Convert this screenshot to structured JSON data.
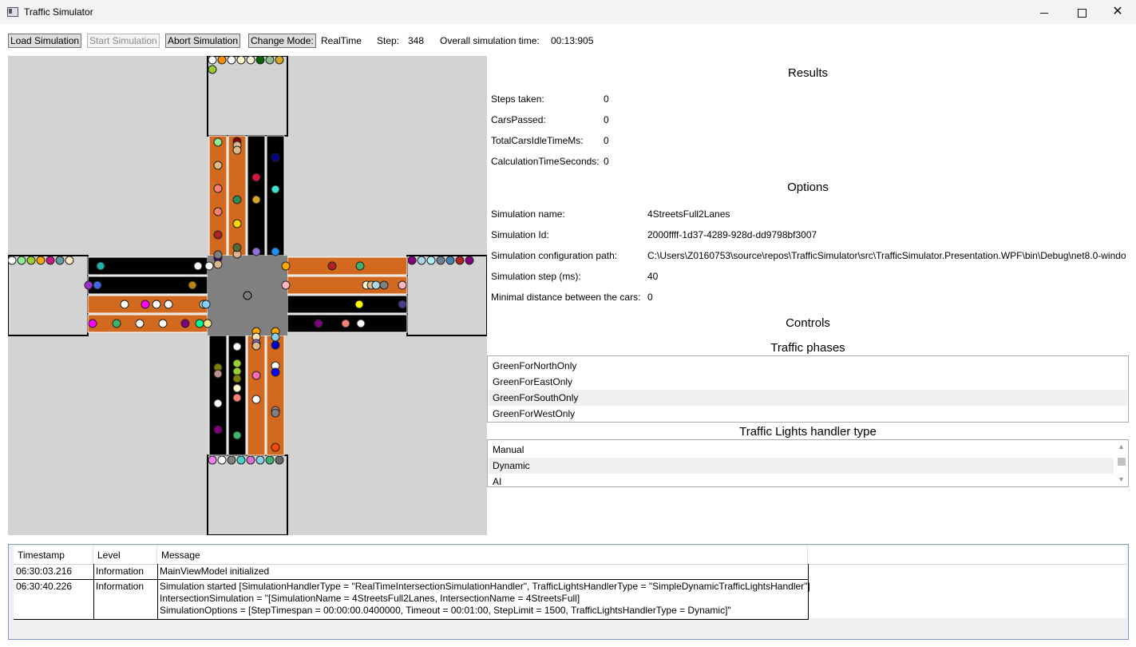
{
  "window": {
    "title": "Traffic Simulator",
    "app_icon": "app-window-icon",
    "controls": [
      "minimize-icon",
      "maximize-icon",
      "close-icon"
    ]
  },
  "toolbar": {
    "load": "Load Simulation",
    "start": "Start Simulation",
    "abort": "Abort Simulation",
    "change_mode": "Change Mode:",
    "mode_value": "RealTime",
    "step_label": "Step:",
    "step_value": "348",
    "overall_label": "Overall simulation time:",
    "overall_value": "00:13:905"
  },
  "results": {
    "title": "Results",
    "rows": [
      {
        "label": "Steps taken:",
        "value": "0"
      },
      {
        "label": "CarsPassed:",
        "value": "0"
      },
      {
        "label": "TotalCarsIdleTimeMs:",
        "value": "0"
      },
      {
        "label": "CalculationTimeSeconds:",
        "value": "0"
      }
    ]
  },
  "options": {
    "title": "Options",
    "rows": [
      {
        "label": "Simulation name:",
        "value": "4StreetsFull2Lanes"
      },
      {
        "label": "Simulation Id:",
        "value": "2000ffff-1d37-4289-928d-dd9798bf3007"
      },
      {
        "label": "Simulation configuration path:",
        "value": "C:\\Users\\Z0160753\\source\\repos\\TrafficSimulator\\src\\TrafficSimulator.Presentation.WPF\\bin\\Debug\\net8.0-windo"
      },
      {
        "label": "Simulation step (ms):",
        "value": "40"
      },
      {
        "label": "Minimal distance between the cars:",
        "value": "0"
      }
    ]
  },
  "controls": {
    "title": "Controls",
    "phases_title": "Traffic phases",
    "phases": [
      "GreenForNorthOnly",
      "GreenForEastOnly",
      "GreenForSouthOnly",
      "GreenForWestOnly"
    ],
    "phases_selected": "GreenForSouthOnly",
    "handler_title": "Traffic Lights handler type",
    "handlers": [
      "Manual",
      "Dynamic",
      "AI"
    ],
    "handler_selected": "Dynamic"
  },
  "log": {
    "columns": [
      "Timestamp",
      "Level",
      "Message"
    ],
    "rows": [
      {
        "timestamp": "06:30:03.216",
        "level": "Information",
        "message": [
          "MainViewModel initialized"
        ]
      },
      {
        "timestamp": "06:30:40.226",
        "level": "Information",
        "message": [
          "Simulation started [SimulationHandlerType = \"RealTimeIntersectionSimulationHandler\", TrafficLightsHandlerType = \"SimpleDynamicTrafficLightsHandler\"]",
          "IntersectionSimulation = \"[SimulationName = 4StreetsFull2Lanes, IntersectionName = 4StreetsFull]",
          "SimulationOptions = [StepTimespan = 00:00:00.0400000, Timeout = 00:01:00, StepLimit = 1500, TrafficLightsHandlerType = Dynamic]\""
        ]
      }
    ]
  },
  "colors": {
    "lane_green": "#d2691e",
    "lane_red": "#000000",
    "road_bg": "#d3d3d3",
    "intersection": "#808080"
  },
  "simulation_view": {
    "lanes": [
      {
        "id": "north-0",
        "state": "green",
        "cars": [
          "#90ee90",
          "#deb887",
          "#fa8072",
          "#fa8072",
          "#b22222",
          "#4b0082",
          "#deb887",
          "#808080"
        ]
      },
      {
        "id": "north-1",
        "state": "green",
        "cars": [
          "#8b0000",
          "#deb887",
          "#deb887",
          "#2e8b57",
          "#ffd700",
          "#deb887",
          "#556b2f"
        ]
      },
      {
        "id": "north-2",
        "state": "red",
        "cars": [
          "#dc143c",
          "#daa520",
          "#9370db"
        ]
      },
      {
        "id": "north-3",
        "state": "red",
        "cars": [
          "#00008b",
          "#40e0d0",
          "#1e90ff"
        ]
      },
      {
        "id": "east-0",
        "state": "green",
        "cars": [
          "#ffa500",
          "#b22222",
          "#3cb371"
        ]
      },
      {
        "id": "east-1",
        "state": "green",
        "cars": [
          "#ffb6c1",
          "#fffacd",
          "#deb887",
          "#add8e6",
          "#808080"
        ]
      },
      {
        "id": "east-2",
        "state": "red",
        "cars": [
          "#ffff00",
          "#483d8b"
        ]
      },
      {
        "id": "east-3",
        "state": "red",
        "cars": [
          "#800080",
          "#fa8072",
          "#ffffff"
        ]
      },
      {
        "id": "south-0",
        "state": "red",
        "cars": [
          "#808000",
          "#bc8f8f",
          "#ffffff",
          "#800080"
        ]
      },
      {
        "id": "south-1",
        "state": "red",
        "cars": [
          "#ffffff",
          "#9acd32",
          "#9acd32",
          "#808000",
          "#fffacd",
          "#fa8072",
          "#3cb371"
        ]
      },
      {
        "id": "south-2",
        "state": "green",
        "cars": [
          "#ffa500",
          "#f5deb3",
          "#9370db",
          "#ff69b4",
          "#ffffff",
          "#deb887"
        ]
      },
      {
        "id": "south-3",
        "state": "green",
        "cars": [
          "#ffa500",
          "#87ceeb",
          "#0000cd",
          "#ffffff",
          "#0000ff",
          "#bc8f8f",
          "#808080",
          "#ff4500"
        ]
      },
      {
        "id": "west-0",
        "state": "red",
        "cars": [
          "#20b2aa",
          "#ffffff",
          "#ffffff"
        ]
      },
      {
        "id": "west-1",
        "state": "red",
        "cars": [
          "#9932cc",
          "#4169e1",
          "#b8860b"
        ]
      },
      {
        "id": "west-2",
        "state": "green",
        "cars": [
          "#ffffff",
          "#ff00ff",
          "#ffffff",
          "#ffffff",
          "#afeeee",
          "#87cefa"
        ]
      },
      {
        "id": "west-3",
        "state": "green",
        "cars": [
          "#ff00ff",
          "#3cb371",
          "#ffffff",
          "#ffffff",
          "#800080",
          "#00fa9a",
          "#f0e68c"
        ]
      }
    ],
    "spawn": {
      "north": [
        "#ffffff",
        "#ff8c00",
        "#ffffff",
        "#fffacd",
        "#f5f5dc",
        "#006400",
        "#8fbc8f",
        "#daa520",
        "#9acd32"
      ],
      "west": [
        "#ffffff",
        "#90ee90",
        "#9acd32",
        "#ffa500",
        "#c71585",
        "#5f9ea0",
        "#ffe4c4"
      ],
      "east": [
        "#800080",
        "#add8e6",
        "#afeeee",
        "#708090",
        "#4682b4",
        "#b22222",
        "#800080"
      ],
      "south": [
        "#ee82ee",
        "#ffffff",
        "#808080",
        "#48d1cc",
        "#da70d6",
        "#87ceeb",
        "#3cb371",
        "#696969"
      ]
    }
  }
}
